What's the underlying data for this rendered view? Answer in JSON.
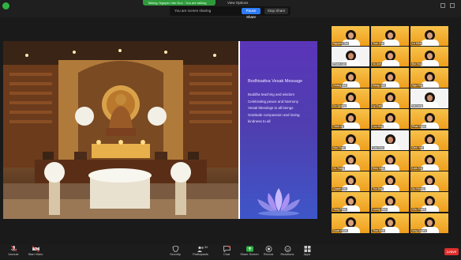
{
  "topbar": {
    "talking_label": "Talking: Nguyen Van Duc · You are talking",
    "view_options_label": "View Options",
    "share_text": "You are screen sharing",
    "pause_label": "Pause Share",
    "stop_label": "Stop Share"
  },
  "slide": {
    "title": "Bodhisattva Vesak Message",
    "lines": [
      "Buddha teaching and wisdom",
      "Celebrating peace and harmony",
      "Vesak blessings to all beings",
      "Gratitude compassion and loving",
      "kindness to all"
    ]
  },
  "gallery": {
    "tiles": [
      {
        "name": "Nguyen Thu"
      },
      {
        "name": "Tran Duc"
      },
      {
        "name": "Le Minh"
      },
      {
        "name": "Pham Lan"
      },
      {
        "name": "Vo Anh"
      },
      {
        "name": "Bui Hoa"
      },
      {
        "name": "Hoang Mai"
      },
      {
        "name": "Dang Linh"
      },
      {
        "name": "Ngo Nhi"
      },
      {
        "name": "Do Quang"
      },
      {
        "name": "Ly Tuan"
      },
      {
        "name": "Ha Long"
      },
      {
        "name": "Trinh Vy"
      },
      {
        "name": "Luu Huy"
      },
      {
        "name": "Phan Ngoc"
      },
      {
        "name": "Mai Thao"
      },
      {
        "name": "Cao Son"
      },
      {
        "name": "Dinh Yen"
      },
      {
        "name": "Vu Trang"
      },
      {
        "name": "Kieu Nam"
      },
      {
        "name": "Lam Chi"
      },
      {
        "name": "Quach Hai"
      },
      {
        "name": "Ton Bao"
      },
      {
        "name": "Au Nhung"
      },
      {
        "name": "Tang Phuc"
      },
      {
        "name": "Luong Hien"
      },
      {
        "name": "Chu Thanh"
      },
      {
        "name": "Doan Khoa"
      },
      {
        "name": "Thai Binh"
      },
      {
        "name": "Ung Quyen"
      }
    ]
  },
  "toolbar": {
    "unmute": "Unmute",
    "start_video": "Start Video",
    "security": "Security",
    "participants": "Participants",
    "chat": "Chat",
    "share_screen": "Share Screen",
    "record": "Record",
    "reactions": "Reactions",
    "apps": "Apps",
    "participants_count": "34",
    "leave": "Leave"
  },
  "colors": {
    "share_green": "#2f9a3c",
    "pause_blue": "#2d7cf6",
    "leave_red": "#e02f2f",
    "slide_purple": "#5a35b8",
    "tile_orange": "#f0ab2a"
  }
}
